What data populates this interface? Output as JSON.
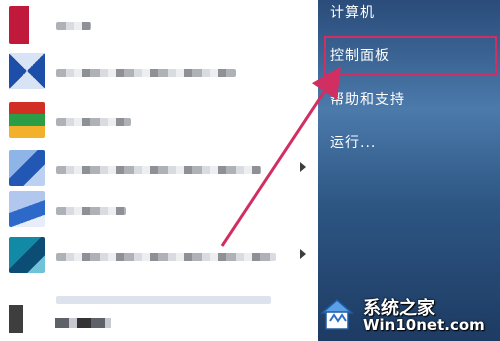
{
  "start_menu": {
    "right_panel": {
      "items": [
        {
          "label": "计算机"
        },
        {
          "label": "控制面板"
        },
        {
          "label": "帮助和支持"
        },
        {
          "label": "运行..."
        }
      ],
      "highlight_color": "#d12e62"
    },
    "left_panel": {
      "programs_count_visible": 6,
      "programs_with_submenu": [
        4,
        6
      ]
    }
  },
  "annotation": {
    "arrow_color": "#d12e62",
    "target": "控制面板"
  },
  "watermark": {
    "brand": "系统之家",
    "url": "Win10net.com"
  }
}
